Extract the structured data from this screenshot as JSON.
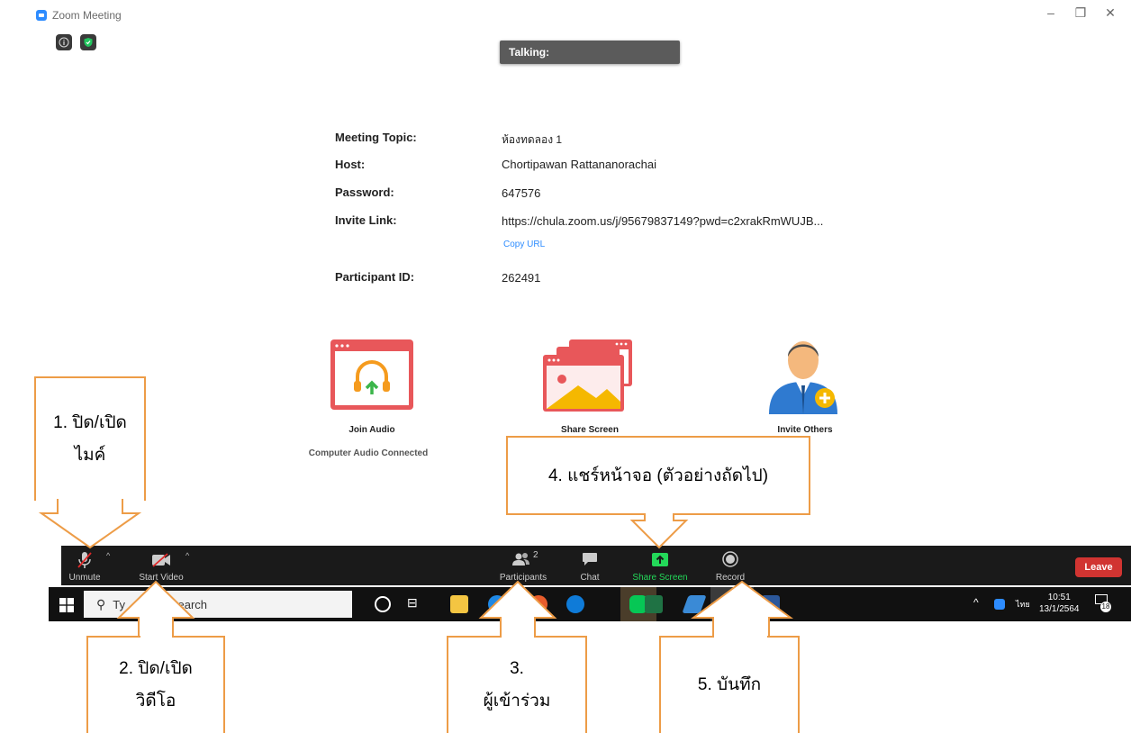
{
  "window": {
    "title": "Zoom Meeting",
    "talking_label": "Talking:",
    "controls": [
      "–",
      "❐",
      "✕"
    ]
  },
  "meeting_info": {
    "topic_label": "Meeting Topic:",
    "topic_value": "ห้องทดลอง 1",
    "host_label": "Host:",
    "host_value": "Chortipawan Rattananorachai",
    "password_label": "Password:",
    "password_value": "647576",
    "invite_label": "Invite Link:",
    "invite_value": "https://chula.zoom.us/j/95679837149?pwd=c2xrakRmWUJB...",
    "copy_url": "Copy URL",
    "participant_id_label": "Participant ID:",
    "participant_id_value": "262491"
  },
  "actions": {
    "join_audio": "Join Audio",
    "audio_status": "Computer Audio Connected",
    "share_screen": "Share Screen",
    "invite_others": "Invite Others"
  },
  "toolbar": {
    "unmute": "Unmute",
    "start_video": "Start Video",
    "participants": "Participants",
    "participants_count": "2",
    "chat": "Chat",
    "share_screen": "Share Screen",
    "record": "Record",
    "leave": "Leave"
  },
  "taskbar": {
    "search_prefix": "Ty",
    "search_suffix": "search",
    "lang": "ไทย",
    "time": "10:51",
    "date": "13/1/2564",
    "notification_count": "18"
  },
  "callouts": {
    "c1_num": "1.",
    "c1_line1": "ปิด/เปิด",
    "c1_line2": "ไมค์",
    "c2_num": "2.",
    "c2_line1": "ปิด/เปิด",
    "c2_line2": "วิดีโอ",
    "c3_num": "3.",
    "c3_line": "ผู้เข้าร่วม",
    "c4_num": "4.",
    "c4_text": "แชร์หน้าจอ (ตัวอย่างถัดไป)",
    "c5_num": "5.",
    "c5_text": "บันทึก"
  },
  "colors": {
    "accent": "#2d8cff",
    "share_green": "#23d959",
    "leave_red": "#d13431",
    "callout_border": "#ed9c47",
    "toolbar_bg": "#1a1a1a"
  }
}
